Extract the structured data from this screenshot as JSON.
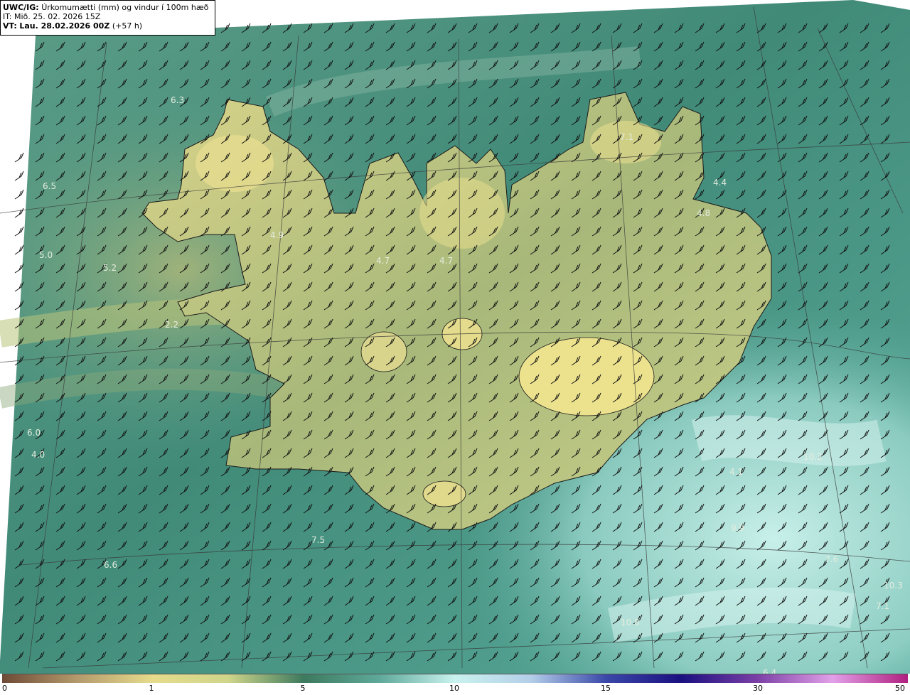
{
  "header": {
    "product_label": "UWC/IG:",
    "title": "Úrkomumætti (mm) og vindur í 100m hæð",
    "initial_time": "IT: Mið. 25. 02. 2026 15Z",
    "valid_label": "VT:",
    "valid_time": "Lau. 28.02.2026 00Z",
    "lead": "(+57 h)"
  },
  "map": {
    "region": "Iceland",
    "colors": {
      "ocean_teal": "#4e9a8a",
      "land_yellow": "#e2d88a",
      "coastline": "#1a1a1a",
      "high_value": "#bde8e4"
    },
    "value_labels": [
      {
        "text": "6.3"
      },
      {
        "text": "6.5"
      },
      {
        "text": "5.0"
      },
      {
        "text": "5.2"
      },
      {
        "text": "4.9"
      },
      {
        "text": "4.7"
      },
      {
        "text": "4.7"
      },
      {
        "text": "7.1"
      },
      {
        "text": "4.4"
      },
      {
        "text": "4.8"
      },
      {
        "text": "2.2"
      },
      {
        "text": "6.0"
      },
      {
        "text": "4.0"
      },
      {
        "text": "7.5"
      },
      {
        "text": "6.6"
      },
      {
        "text": "4.1"
      },
      {
        "text": "10.2"
      },
      {
        "text": "9.9"
      },
      {
        "text": "7.6"
      },
      {
        "text": "10.8"
      },
      {
        "text": "10.3"
      },
      {
        "text": "7.1"
      },
      {
        "text": "6.4"
      }
    ]
  },
  "colorbar": {
    "ticks": [
      "0",
      "1",
      "5",
      "10",
      "15",
      "30",
      "50"
    ],
    "stops": [
      "#6e4a36",
      "#b49a6c",
      "#e6dc8c",
      "#cfd58a",
      "#3d7a5e",
      "#5fa99a",
      "#c9f2ee",
      "#b4cfe9",
      "#3b48a8",
      "#1a1080",
      "#7a3fa6",
      "#e2a0e8",
      "#b02080"
    ]
  }
}
